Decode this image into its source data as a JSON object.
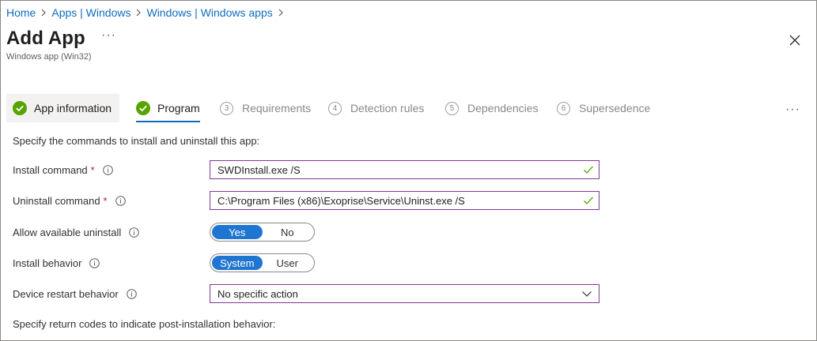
{
  "breadcrumb": [
    {
      "label": "Home"
    },
    {
      "label": "Apps | Windows"
    },
    {
      "label": "Windows | Windows apps"
    }
  ],
  "page": {
    "title": "Add App",
    "subtitle": "Windows app (Win32)",
    "more_label": "···"
  },
  "tabs": [
    {
      "label": "App information",
      "state": "completed"
    },
    {
      "label": "Program",
      "state": "completed-active"
    },
    {
      "label": "Requirements",
      "number": "3",
      "state": "pending"
    },
    {
      "label": "Detection rules",
      "number": "4",
      "state": "pending"
    },
    {
      "label": "Dependencies",
      "number": "5",
      "state": "pending"
    },
    {
      "label": "Supersedence",
      "number": "6",
      "state": "pending"
    }
  ],
  "tabs_more_label": "···",
  "form": {
    "intro": "Specify the commands to install and uninstall this app:",
    "install_command": {
      "label": "Install command",
      "required_mark": "*",
      "value": "SWDInstall.exe /S"
    },
    "uninstall_command": {
      "label": "Uninstall command",
      "required_mark": "*",
      "value": "C:\\Program Files (x86)\\Exoprise\\Service\\Uninst.exe /S"
    },
    "allow_uninstall": {
      "label": "Allow available uninstall",
      "options": [
        "Yes",
        "No"
      ],
      "selected": "Yes"
    },
    "install_behavior": {
      "label": "Install behavior",
      "options": [
        "System",
        "User"
      ],
      "selected": "System"
    },
    "device_restart": {
      "label": "Device restart behavior",
      "value": "No specific action"
    },
    "outro": "Specify return codes to indicate post-installation behavior:"
  },
  "colors": {
    "link": "#0f6cbd",
    "success": "#57a300",
    "field_border": "#7f3b8f",
    "toggle_on": "#1f76d1",
    "required": "#a4262c"
  },
  "icons": {
    "breadcrumb_separator": "chevron-right-icon",
    "close": "close-icon",
    "tab_done": "checkmark-circle-icon",
    "info": "info-icon",
    "valid": "checkmark-icon",
    "dropdown": "chevron-down-icon"
  }
}
